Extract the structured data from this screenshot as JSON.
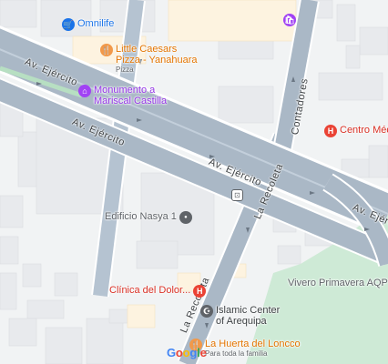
{
  "pois": [
    {
      "id": "omnilife",
      "name": "Omnilife",
      "icon": "cart-icon",
      "glyph": "🛒",
      "color": "#1a73e8",
      "text_color": "#1a73e8"
    },
    {
      "id": "little-caesars",
      "name": "Little Caesars\nPizza - Yanahuara",
      "sub": "Pizza",
      "icon": "fork-knife-icon",
      "glyph": "🍴",
      "color": "#f2994a",
      "text_color": "#e37400"
    },
    {
      "id": "monumento",
      "name": "Monumento a\nMariscal Castilla",
      "icon": "monument-icon",
      "glyph": "⌂",
      "color": "#a142f4",
      "text_color": "#9334e6"
    },
    {
      "id": "centro-medico",
      "name": "Centro Médic",
      "icon": "hospital-icon",
      "glyph": "H",
      "color": "#ea4335",
      "text_color": "#d93025"
    },
    {
      "id": "edificio-nasya",
      "name": "Edificio Nasya 1",
      "icon": "place-icon",
      "glyph": "●",
      "color": "#5f6368",
      "text_color": "#5f6368"
    },
    {
      "id": "clinica-dolor",
      "name": "Clínica del Dolor...",
      "icon": "hospital-icon",
      "glyph": "H",
      "color": "#ea4335",
      "text_color": "#d93025"
    },
    {
      "id": "vivero",
      "name": "Vivero Primavera AQP",
      "icon": "",
      "glyph": "",
      "color": "",
      "text_color": "#5f6368"
    },
    {
      "id": "islamic-center",
      "name": "Islamic Center\nof Arequipa",
      "icon": "mosque-icon",
      "glyph": "☪",
      "color": "#5f6368",
      "text_color": "#3c4043"
    },
    {
      "id": "la-huerta",
      "name": "La Huerta del Loncco",
      "sub": "Para toda la familia",
      "icon": "fork-knife-icon",
      "glyph": "🍴",
      "color": "#f2994a",
      "text_color": "#e37400"
    },
    {
      "id": "shopping",
      "name": "",
      "icon": "shopping-bag-icon",
      "glyph": "🛍",
      "color": "#a142f4",
      "text_color": "#9334e6"
    }
  ],
  "streets": {
    "av_ejercito": "Av. Ejército",
    "contadores": "Contadores",
    "la_recoleta": "La Recoleta"
  },
  "logo": {
    "letters": [
      "G",
      "o",
      "o",
      "g",
      "l",
      "e"
    ],
    "colors": [
      "#4285f4",
      "#ea4335",
      "#fbbc05",
      "#4285f4",
      "#34a853",
      "#ea4335"
    ]
  },
  "bus_icon": "bus-stop-icon",
  "colors": {
    "background": "#f1f3f4",
    "road": "#aab8c6",
    "road_edge": "#ffffff",
    "park": "#ceead6",
    "building": "#e8eaed",
    "building_warm": "#fdf3e0"
  }
}
